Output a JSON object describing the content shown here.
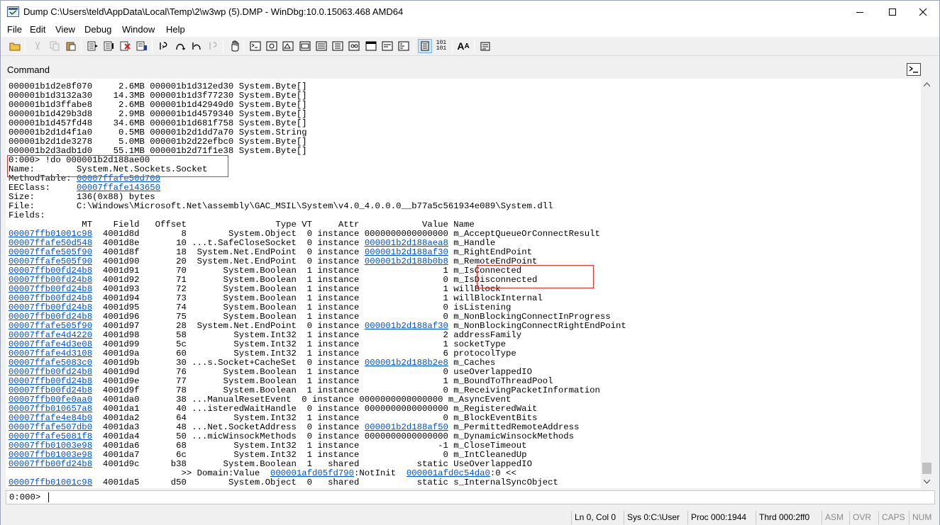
{
  "window": {
    "title": "Dump C:\\Users\\teld\\AppData\\Local\\Temp\\2\\w3wp (5).DMP - WinDbg:10.0.15063.468 AMD64"
  },
  "menu": [
    "File",
    "Edit",
    "View",
    "Debug",
    "Window",
    "Help"
  ],
  "toolbar_icons": [
    "open-icon",
    "cut-icon",
    "copy-icon",
    "paste-icon",
    "go-icon",
    "restart-icon",
    "stop-debugging-icon",
    "break-icon",
    "step-into-icon",
    "step-over-icon",
    "step-out-icon",
    "run-to-cursor-icon",
    "hand-icon",
    "command-window-icon",
    "watch-window-icon",
    "locals-icon",
    "registers-icon",
    "memory-icon",
    "call-stack-icon",
    "disassembly-icon",
    "scratch-pad-icon",
    "source-mode-icon",
    "hex-mode-icon",
    "font-icon",
    "options-icon"
  ],
  "command_window": {
    "title": "Command",
    "lines": [
      [
        {
          "t": "000001b1d2e8f070     2.6MB 000001b1d312ed30 System.Byte[]"
        }
      ],
      [
        {
          "t": "000001b1d3132a30    14.3MB 000001b1d3f77230 System.Byte[]"
        }
      ],
      [
        {
          "t": "000001b1d3ffabe8     2.6MB 000001b1d42949d0 System.Byte[]"
        }
      ],
      [
        {
          "t": "000001b1d429b3d8     2.9MB 000001b1d4579340 System.Byte[]"
        }
      ],
      [
        {
          "t": "000001b1d457fd48    34.6MB 000001b1d681f758 System.Byte[]"
        }
      ],
      [
        {
          "t": "000001b2d1d4f1a0     0.5MB 000001b2d1dd7a70 System.String"
        }
      ],
      [
        {
          "t": "000001b2d1de3278     5.0MB 000001b2d22efbc0 System.Byte[]"
        }
      ],
      [
        {
          "t": "000001b2d3adb1d0    55.1MB 000001b2d71f1e38 System.Byte[]"
        }
      ],
      [
        {
          "t": "0:000> !do 000001b2d188ae00"
        }
      ],
      [
        {
          "t": "Name:        System.Net.Sockets.Socket"
        }
      ],
      [
        {
          "t": "MethodTable: "
        },
        {
          "t": "00007ffafe50d700",
          "l": 1
        }
      ],
      [
        {
          "t": "EEClass:     "
        },
        {
          "t": "00007ffafe143650",
          "l": 1
        }
      ],
      [
        {
          "t": "Size:        136(0x88) bytes"
        }
      ],
      [
        {
          "t": "File:        C:\\Windows\\Microsoft.Net\\assembly\\GAC_MSIL\\System\\v4.0_4.0.0.0__b77a5c561934e089\\System.dll"
        }
      ],
      [
        {
          "t": "Fields:"
        }
      ],
      [
        {
          "t": "              MT    Field   Offset                 Type VT     Attr            Value Name"
        }
      ],
      [
        {
          "t": "00007ffb01001c98",
          "l": 1
        },
        {
          "t": "  4001d8d        8        System.Object  0 instance 0000000000000000 m_AcceptQueueOrConnectResult"
        }
      ],
      [
        {
          "t": "00007ffafe50d548",
          "l": 1
        },
        {
          "t": "  4001d8e       10 ...t.SafeCloseSocket  0 instance "
        },
        {
          "t": "000001b2d188aea8",
          "l": 1
        },
        {
          "t": " m_Handle"
        }
      ],
      [
        {
          "t": "00007ffafe505f90",
          "l": 1
        },
        {
          "t": "  4001d8f       18  System.Net.EndPoint  0 instance "
        },
        {
          "t": "000001b2d188af30",
          "l": 1
        },
        {
          "t": " m_RightEndPoint"
        }
      ],
      [
        {
          "t": "00007ffafe505f90",
          "l": 1
        },
        {
          "t": "  4001d90       20  System.Net.EndPoint  0 instance "
        },
        {
          "t": "000001b2d188b0b8",
          "l": 1
        },
        {
          "t": " m_RemoteEndPoint"
        }
      ],
      [
        {
          "t": "00007ffb00fd24b8",
          "l": 1
        },
        {
          "t": "  4001d91       70       System.Boolean  1 instance                1 m_IsConnected"
        }
      ],
      [
        {
          "t": "00007ffb00fd24b8",
          "l": 1
        },
        {
          "t": "  4001d92       71       System.Boolean  1 instance                0 m_IsDisconnected"
        }
      ],
      [
        {
          "t": "00007ffb00fd24b8",
          "l": 1
        },
        {
          "t": "  4001d93       72       System.Boolean  1 instance                1 willBlock"
        }
      ],
      [
        {
          "t": "00007ffb00fd24b8",
          "l": 1
        },
        {
          "t": "  4001d94       73       System.Boolean  1 instance                1 willBlockInternal"
        }
      ],
      [
        {
          "t": "00007ffb00fd24b8",
          "l": 1
        },
        {
          "t": "  4001d95       74       System.Boolean  1 instance                0 isListening"
        }
      ],
      [
        {
          "t": "00007ffb00fd24b8",
          "l": 1
        },
        {
          "t": "  4001d96       75       System.Boolean  1 instance                0 m_NonBlockingConnectInProgress"
        }
      ],
      [
        {
          "t": "00007ffafe505f90",
          "l": 1
        },
        {
          "t": "  4001d97       28  System.Net.EndPoint  0 instance "
        },
        {
          "t": "000001b2d188af30",
          "l": 1
        },
        {
          "t": " m_NonBlockingConnectRightEndPoint"
        }
      ],
      [
        {
          "t": "00007ffafe4d4220",
          "l": 1
        },
        {
          "t": "  4001d98       58         System.Int32  1 instance                2 addressFamily"
        }
      ],
      [
        {
          "t": "00007ffafe4d3e08",
          "l": 1
        },
        {
          "t": "  4001d99       5c         System.Int32  1 instance                1 socketType"
        }
      ],
      [
        {
          "t": "00007ffafe4d3108",
          "l": 1
        },
        {
          "t": "  4001d9a       60         System.Int32  1 instance                6 protocolType"
        }
      ],
      [
        {
          "t": "00007ffafe5083c0",
          "l": 1
        },
        {
          "t": "  4001d9b       30 ...s.Socket+CacheSet  0 instance "
        },
        {
          "t": "000001b2d188b2e8",
          "l": 1
        },
        {
          "t": " m_Caches"
        }
      ],
      [
        {
          "t": "00007ffb00fd24b8",
          "l": 1
        },
        {
          "t": "  4001d9d       76       System.Boolean  1 instance                0 useOverlappedIO"
        }
      ],
      [
        {
          "t": "00007ffb00fd24b8",
          "l": 1
        },
        {
          "t": "  4001d9e       77       System.Boolean  1 instance                1 m_BoundToThreadPool"
        }
      ],
      [
        {
          "t": "00007ffb00fd24b8",
          "l": 1
        },
        {
          "t": "  4001d9f       78       System.Boolean  1 instance                0 m_ReceivingPacketInformation"
        }
      ],
      [
        {
          "t": "00007ffb00fe0aa0",
          "l": 1
        },
        {
          "t": "  4001da0       38 ...ManualResetEvent  0 instance 0000000000000000 m_AsyncEvent"
        }
      ],
      [
        {
          "t": "00007ffb010657a8",
          "l": 1
        },
        {
          "t": "  4001da1       40 ...isteredWaitHandle  0 instance 0000000000000000 m_RegisteredWait"
        }
      ],
      [
        {
          "t": "00007ffafe4e84b0",
          "l": 1
        },
        {
          "t": "  4001da2       64         System.Int32  1 instance                0 m_BlockEventBits"
        }
      ],
      [
        {
          "t": "00007ffafe507db0",
          "l": 1
        },
        {
          "t": "  4001da3       48 ...Net.SocketAddress  0 instance "
        },
        {
          "t": "000001b2d188af50",
          "l": 1
        },
        {
          "t": " m_PermittedRemoteAddress"
        }
      ],
      [
        {
          "t": "00007ffafe5081f8",
          "l": 1
        },
        {
          "t": "  4001da4       50 ...micWinsockMethods  0 instance 0000000000000000 m_DynamicWinsockMethods"
        }
      ],
      [
        {
          "t": "00007ffb01003e98",
          "l": 1
        },
        {
          "t": "  4001da6       68         System.Int32  1 instance               -1 m_CloseTimeout"
        }
      ],
      [
        {
          "t": "00007ffb01003e98",
          "l": 1
        },
        {
          "t": "  4001da7       6c         System.Int32  1 instance                0 m_IntCleanedUp"
        }
      ],
      [
        {
          "t": "00007ffb00fd24b8",
          "l": 1
        },
        {
          "t": "  4001d9c      b38       System.Boolean  1   shared           static UseOverlappedIO"
        }
      ],
      [
        {
          "t": "                                 >> Domain:Value  "
        },
        {
          "t": "000001afd05fd790",
          "l": 1
        },
        {
          "t": ":NotInit  "
        },
        {
          "t": "000001afd0c54da0",
          "l": 1
        },
        {
          "t": ":0 <<"
        }
      ],
      [
        {
          "t": "00007ffb01001c98",
          "l": 1
        },
        {
          "t": "  4001da5      d50        System.Object  0   shared           static s_InternalSyncObject"
        }
      ]
    ],
    "prompt": "0:000>"
  },
  "status": [
    {
      "t": "Ln 0, Col 0",
      "dim": false
    },
    {
      "t": "Sys 0:C:\\User",
      "dim": false
    },
    {
      "t": "Proc 000:1944",
      "dim": false
    },
    {
      "t": "Thrd 000:2ff0",
      "dim": false
    },
    {
      "t": "ASM",
      "dim": true
    },
    {
      "t": "OVR",
      "dim": true
    },
    {
      "t": "CAPS",
      "dim": true
    },
    {
      "t": "NUM",
      "dim": true
    }
  ]
}
